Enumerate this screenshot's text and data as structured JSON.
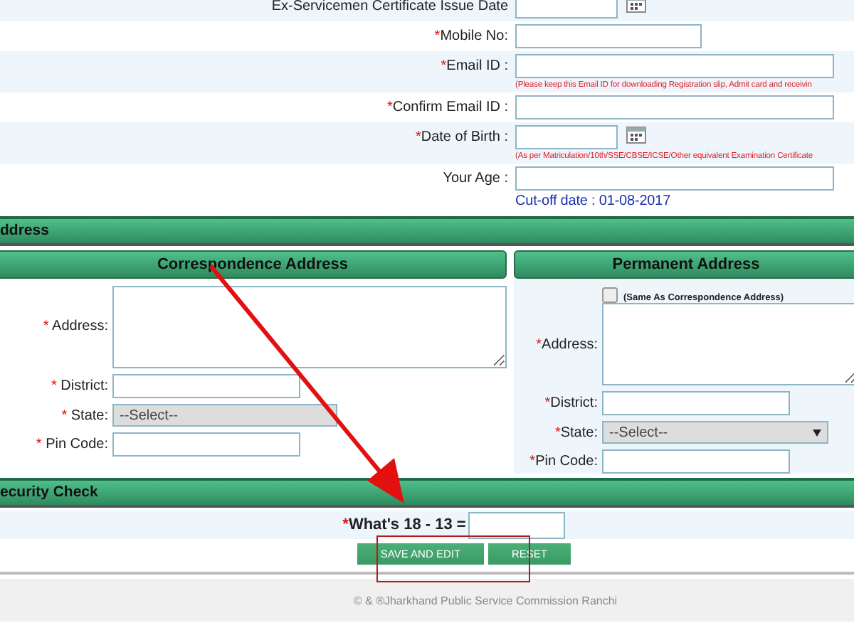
{
  "personal_fields": [
    {
      "label": "Ex-Servicemen Certificate Issue Date",
      "kind": "date"
    },
    {
      "label": "Mobile No:",
      "required_mark": "*",
      "kind": "text"
    },
    {
      "label": "Email ID :",
      "required_mark": "*",
      "kind": "text",
      "note": {
        "text": "(Please keep this Email ID for downloading Registration slip, Admit card and receivin",
        "kind": "warning"
      }
    },
    {
      "label": "Confirm Email ID :",
      "required_mark": "*",
      "kind": "text"
    },
    {
      "label": "Date of Birth :",
      "required_mark": "*",
      "kind": "date",
      "note": {
        "text": "(As per Matriculation/10th/SSE/CBSE/ICSE/Other equivalent Examination Certificate",
        "kind": "warning"
      }
    },
    {
      "label": "Your Age :",
      "kind": "text",
      "note": {
        "text": "Cut-off date : 01-08-2017",
        "kind": "info"
      }
    }
  ],
  "address_section": {
    "title": "ddress",
    "correspondence": {
      "title": "Correspondence Address",
      "fields": [
        {
          "label": "Address:",
          "required_mark": "*",
          "kind": "textarea"
        },
        {
          "label": "District:",
          "required_mark": "*",
          "kind": "text"
        },
        {
          "label": "State:",
          "required_mark": "*",
          "kind": "select",
          "value": "--Select--"
        },
        {
          "label": "Pin Code:",
          "required_mark": "*",
          "kind": "text"
        }
      ]
    },
    "permanent": {
      "title": "Permanent Address",
      "same_as": {
        "label": "(Same As Correspondence Address)",
        "checked": false
      },
      "fields": [
        {
          "label": "Address:",
          "required_mark": "*",
          "kind": "textarea"
        },
        {
          "label": "District:",
          "required_mark": "*",
          "kind": "text"
        },
        {
          "label": "State:",
          "required_mark": "*",
          "kind": "select",
          "value": "--Select--"
        },
        {
          "label": "Pin Code:",
          "required_mark": "*",
          "kind": "text"
        }
      ]
    }
  },
  "security_check": {
    "title": "ecurity Check",
    "question": "What's 18 - 13 =",
    "required_mark": "*"
  },
  "buttons": [
    "SAVE AND EDIT",
    "RESET"
  ],
  "footer": "© & ®Jharkhand Public Service Commission Ranchi"
}
